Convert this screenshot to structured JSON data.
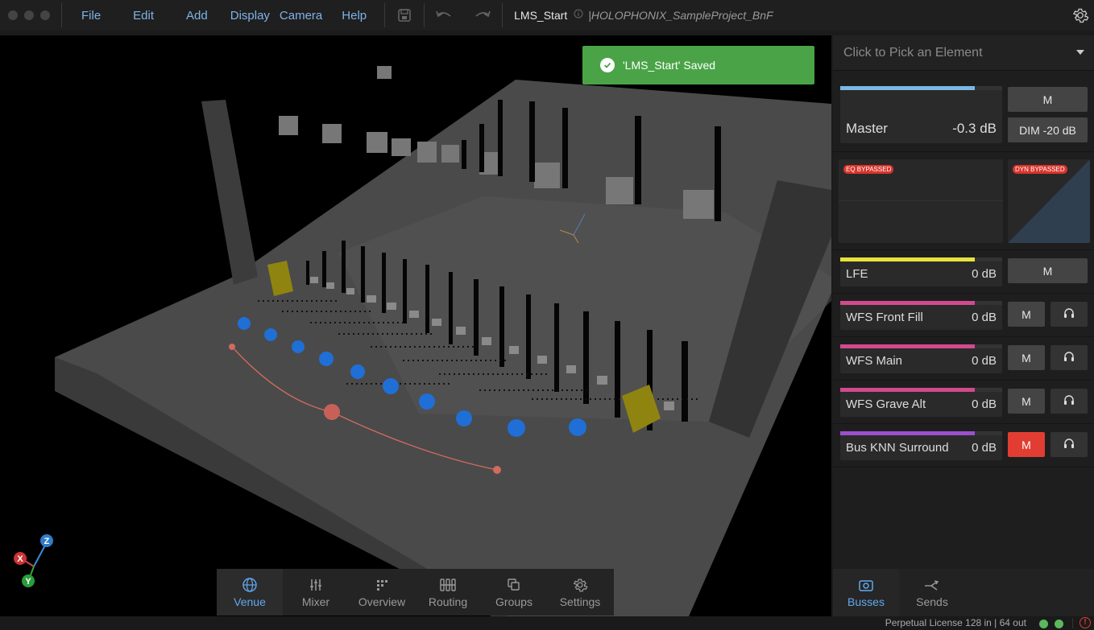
{
  "topbar": {
    "menu": [
      "File",
      "Edit",
      "Add",
      "Display",
      "Camera",
      "Help"
    ],
    "document_title": "LMS_Start",
    "project_name": "|HOLOPHONIX_SampleProject_BnF"
  },
  "toast": {
    "message": "'LMS_Start' Saved",
    "color": "#4aa447"
  },
  "axes": {
    "x": "X",
    "y": "Y",
    "z": "Z"
  },
  "bottom_tabs": [
    {
      "label": "Venue",
      "icon": "globe-icon",
      "active": true
    },
    {
      "label": "Mixer",
      "icon": "sliders-icon",
      "active": false
    },
    {
      "label": "Overview",
      "icon": "overview-icon",
      "active": false
    },
    {
      "label": "Routing",
      "icon": "routing-icon",
      "active": false
    },
    {
      "label": "Groups",
      "icon": "groups-icon",
      "active": false
    },
    {
      "label": "Settings",
      "icon": "gear-icon",
      "active": false
    }
  ],
  "panel": {
    "picker_placeholder": "Click to Pick an Element",
    "master": {
      "name": "Master",
      "value": "-0.3 dB",
      "mute_label": "M",
      "dim_label": "DIM -20 dB",
      "meter_color": "#7ab8e6",
      "meter_level": 0.83
    },
    "eq_badge": "EQ BYPASSED",
    "dyn_badge": "DYN BYPASSED",
    "busses": [
      {
        "name": "LFE",
        "value": "0 dB",
        "mute_label": "M",
        "muted": false,
        "solo": false,
        "meter_color": "#e8e23a",
        "meter_level": 0.83
      },
      {
        "name": "WFS Front Fill",
        "value": "0 dB",
        "mute_label": "M",
        "muted": false,
        "solo": true,
        "meter_color": "#d14a8e",
        "meter_level": 0.83
      },
      {
        "name": "WFS Main",
        "value": "0 dB",
        "mute_label": "M",
        "muted": false,
        "solo": true,
        "meter_color": "#d14a8e",
        "meter_level": 0.83
      },
      {
        "name": "WFS Grave Alt",
        "value": "0 dB",
        "mute_label": "M",
        "muted": false,
        "solo": true,
        "meter_color": "#d14a8e",
        "meter_level": 0.83
      },
      {
        "name": "Bus KNN Surround",
        "value": "0 dB",
        "mute_label": "M",
        "muted": true,
        "solo": true,
        "meter_color": "#9c4fcf",
        "meter_level": 0.83
      }
    ],
    "tabs": [
      {
        "label": "Busses",
        "icon": "busses-icon",
        "active": true
      },
      {
        "label": "Sends",
        "icon": "sends-icon",
        "active": false
      }
    ]
  },
  "status": {
    "license": "Perpetual License 128 in | 64 out",
    "mute_active_color": "#e23d33",
    "accent": "#62a8ef"
  }
}
